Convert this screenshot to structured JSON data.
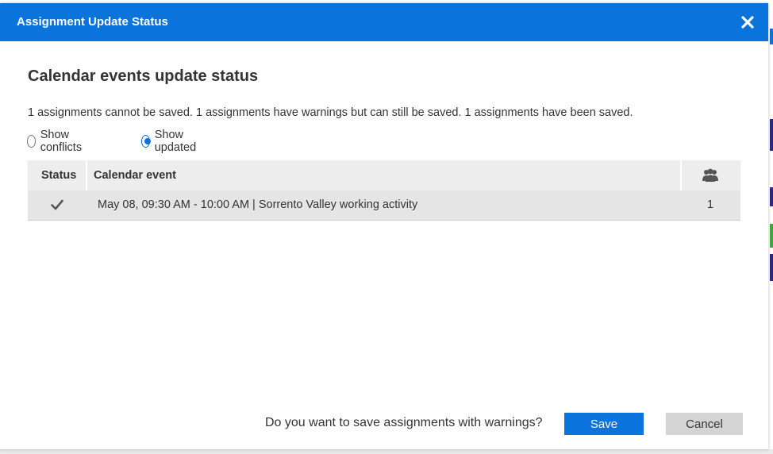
{
  "dialog": {
    "title": "Assignment Update Status",
    "heading": "Calendar events update status",
    "summary": "1 assignments cannot be saved. 1 assignments have warnings but can still be saved. 1 assignments have been saved.",
    "close_icon": "close-icon"
  },
  "filters": {
    "options": [
      {
        "label": "Show conflicts",
        "checked": false
      },
      {
        "label": "Show updated",
        "checked": true
      }
    ]
  },
  "table": {
    "columns": {
      "status": "Status",
      "event": "Calendar event",
      "attendees_icon": "people-icon"
    },
    "rows": [
      {
        "status_icon": "checkmark-icon",
        "event": "May 08, 09:30 AM - 10:00 AM | Sorrento Valley working activity",
        "count": "1"
      }
    ]
  },
  "footer": {
    "question": "Do you want to save assignments with warnings?",
    "save_label": "Save",
    "cancel_label": "Cancel"
  },
  "colors": {
    "accent": "#0a73dc",
    "header_bg": "#ededed",
    "row_bg": "#e5e5e5",
    "cancel_bg": "#d4d4d4"
  }
}
